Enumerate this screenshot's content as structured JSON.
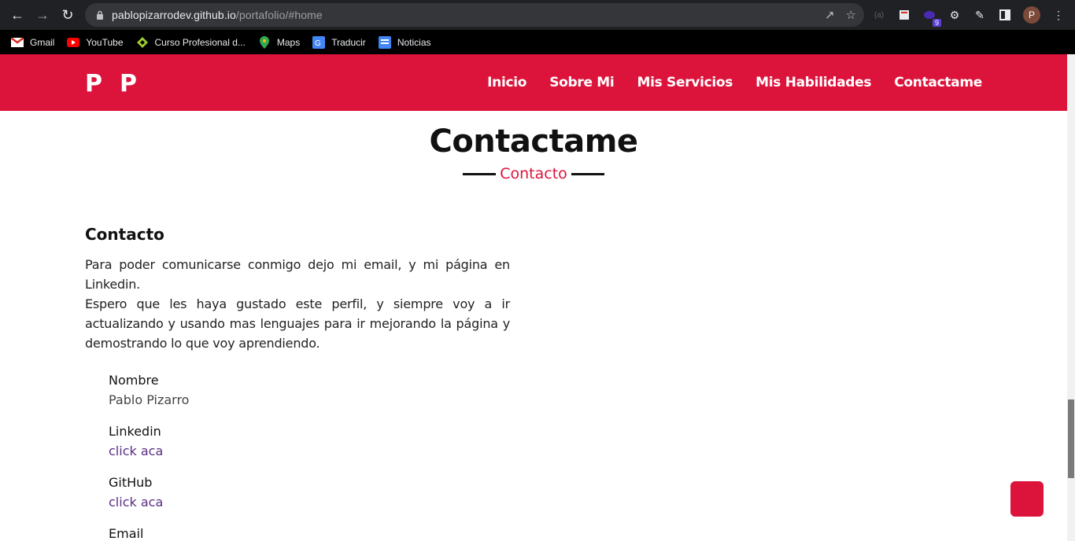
{
  "browser": {
    "url_host": "pablopizarrodev.github.io",
    "url_path": "/portafolio/#home",
    "profile_initial": "P",
    "extension_badge": "9"
  },
  "bookmarks": [
    {
      "label": "Gmail",
      "icon": "gmail-icon"
    },
    {
      "label": "YouTube",
      "icon": "youtube-icon"
    },
    {
      "label": "Curso Profesional d...",
      "icon": "course-icon"
    },
    {
      "label": "Maps",
      "icon": "maps-icon"
    },
    {
      "label": "Traducir",
      "icon": "translate-icon"
    },
    {
      "label": "Noticias",
      "icon": "news-icon"
    }
  ],
  "site": {
    "logo": "PP",
    "menu": [
      "Inicio",
      "Sobre Mi",
      "Mis Servicios",
      "Mis Habilidades",
      "Contactame"
    ],
    "section_title": "Contactame",
    "section_subtitle": "Contacto",
    "content_heading": "Contacto",
    "paragraph_1": "Para poder comunicarse conmigo dejo mi email, y mi página en Linkedin.",
    "paragraph_2": "Espero que les haya gustado este perfil, y siempre voy a ir actualizando y usando mas lenguajes para ir mejorando la página y demostrando lo que voy aprendiendo.",
    "items": {
      "nombre_label": "Nombre",
      "nombre_value": "Pablo Pizarro",
      "linkedin_label": "Linkedin",
      "linkedin_link": "click aca",
      "github_label": "GitHub",
      "github_link": "click aca",
      "email_label": "Email"
    }
  },
  "colors": {
    "brand": "#dc143c",
    "link": "#5a2d82"
  }
}
